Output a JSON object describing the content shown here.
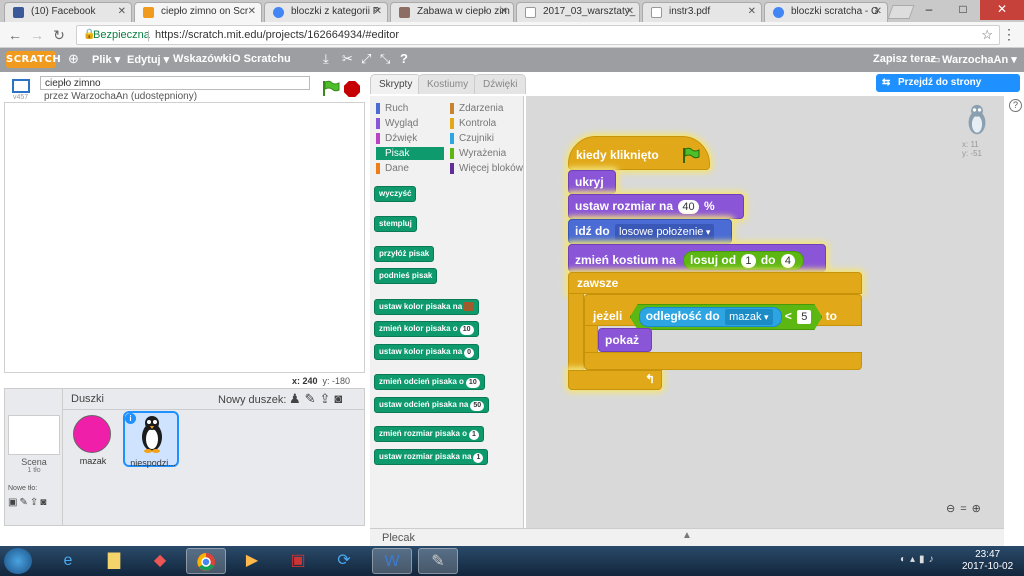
{
  "browser": {
    "tabs": [
      {
        "label": "(10) Facebook",
        "color": "#3b5998"
      },
      {
        "label": "ciepło zimno on Scr",
        "color": "#f09a1e"
      },
      {
        "label": "bloczki z kategorii P",
        "color": "#4285f4"
      },
      {
        "label": "Zabawa w ciepło zim",
        "color": "#8d6e63"
      },
      {
        "label": "2017_03_warsztaty_",
        "color": "#9e9e9e"
      },
      {
        "label": "instr3.pdf",
        "color": "#9e9e9e"
      },
      {
        "label": "bloczki scratcha - G",
        "color": "#4285f4"
      }
    ],
    "secure_label": "Bezpieczna",
    "url": "https://scratch.mit.edu/projects/162664934/#editor"
  },
  "scratch_menu": {
    "logo": "SCRATCH",
    "items": [
      "Plik ▾",
      "Edytuj ▾",
      "Wskazówki",
      "O Scratchu"
    ],
    "save_now": "Zapisz teraz",
    "user": "WarzochaAn ▾"
  },
  "go_project_label": "Przejdź do strony projektu",
  "stage": {
    "version": "v457",
    "project_title": "ciepło zimno",
    "byline": "przez WarzochaAn (udostępniony)",
    "mouse_x": "x: 240",
    "mouse_y": "y: -180"
  },
  "sprites_pane": {
    "scene_label": "Scena",
    "scene_sub": "1 tło",
    "new_backdrop": "Nowe tło:",
    "sprites_title": "Duszki",
    "new_sprite": "Nowy duszek:",
    "sprites": [
      {
        "name": "mazak"
      },
      {
        "name": "niespodzi..."
      }
    ]
  },
  "palette_tabs": [
    "Skrypty",
    "Kostiumy",
    "Dźwięki"
  ],
  "categories": [
    {
      "label": "Ruch",
      "color": "#4a6cd4"
    },
    {
      "label": "Zdarzenia",
      "color": "#c88330"
    },
    {
      "label": "Wygląd",
      "color": "#8a55d7"
    },
    {
      "label": "Kontrola",
      "color": "#e1a91a"
    },
    {
      "label": "Dźwięk",
      "color": "#bb42c3"
    },
    {
      "label": "Czujniki",
      "color": "#2ca5e2"
    },
    {
      "label": "Pisak",
      "color": "#0e9a6c"
    },
    {
      "label": "Wyrażenia",
      "color": "#5cb712"
    },
    {
      "label": "Dane",
      "color": "#ee7d16"
    },
    {
      "label": "Więcej bloków",
      "color": "#632d99"
    }
  ],
  "pen_blocks": {
    "clear": "wyczyść",
    "stamp": "stempluj",
    "pen_down": "przyłóż pisak",
    "pen_up": "podnieś pisak",
    "set_color": "ustaw kolor pisaka na",
    "change_color": "zmień kolor pisaka o",
    "change_color_val": "10",
    "set_color_num": "ustaw kolor pisaka na",
    "set_color_num_val": "0",
    "change_shade": "zmień odcień pisaka o",
    "change_shade_val": "10",
    "set_shade": "ustaw odcień pisaka na",
    "set_shade_val": "50",
    "change_size": "zmień rozmiar pisaka o",
    "change_size_val": "1",
    "set_size": "ustaw rozmiar pisaka na",
    "set_size_val": "1"
  },
  "script": {
    "hat": "kiedy kliknięto",
    "hide": "ukryj",
    "set_size": "ustaw rozmiar na",
    "set_size_val": "40",
    "set_size_pct": "%",
    "go_to": "idź do",
    "go_to_target": "losowe położenie",
    "switch_costume": "zmień kostium na",
    "random": "losuj od",
    "random_from": "1",
    "random_word": "do",
    "random_to": "4",
    "forever": "zawsze",
    "if": "jeżeli",
    "distance": "odległość do",
    "distance_target": "mazak",
    "lt": "<",
    "lt_val": "5",
    "then": "to",
    "show": "pokaż"
  },
  "sprite_corner": {
    "x": "x: 11",
    "y": "y: -51"
  },
  "plecak": "Plecak",
  "clock": {
    "time": "23:47",
    "date": "2017-10-02"
  }
}
